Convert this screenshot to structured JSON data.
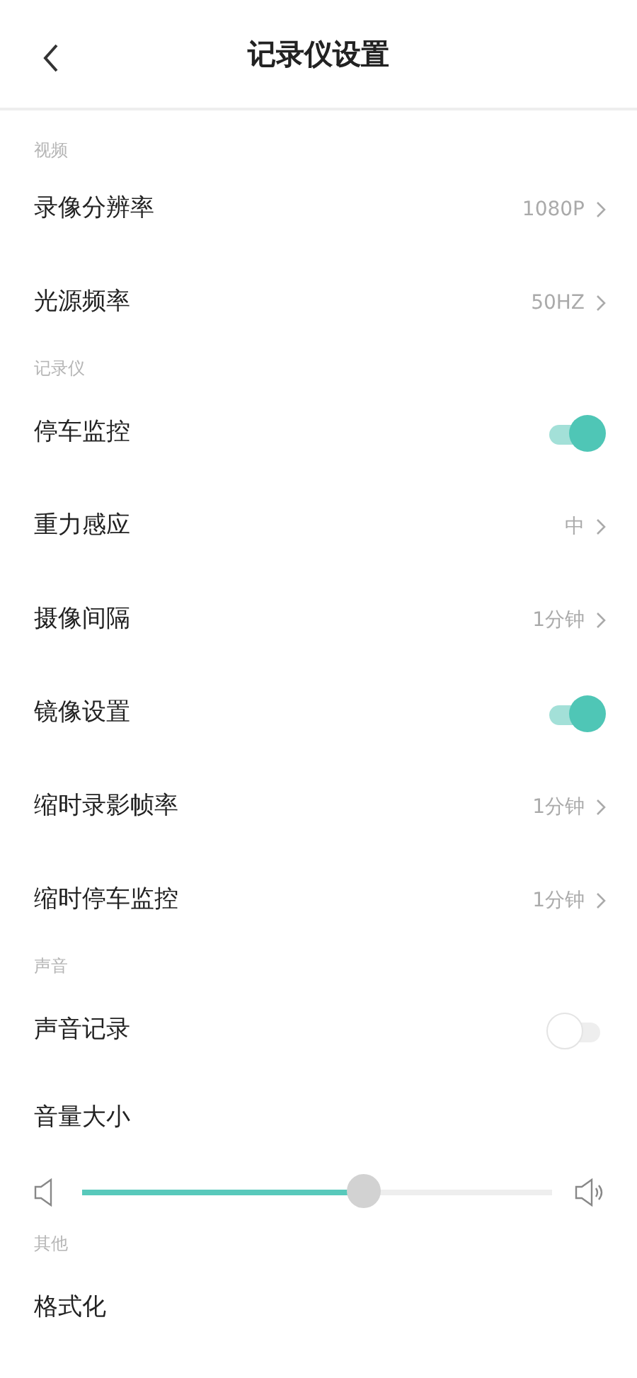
{
  "header": {
    "title": "记录仪设置"
  },
  "sections": [
    {
      "label": "视频",
      "items": [
        {
          "kind": "link",
          "label": "录像分辨率",
          "value": "1080P"
        },
        {
          "kind": "link",
          "label": "光源频率",
          "value": "50HZ"
        }
      ]
    },
    {
      "label": "记录仪",
      "items": [
        {
          "kind": "toggle",
          "label": "停车监控",
          "on": true
        },
        {
          "kind": "link",
          "label": "重力感应",
          "value": "中"
        },
        {
          "kind": "link",
          "label": "摄像间隔",
          "value": "1分钟"
        },
        {
          "kind": "toggle",
          "label": "镜像设置",
          "on": true
        },
        {
          "kind": "link",
          "label": "缩时录影帧率",
          "value": "1分钟"
        },
        {
          "kind": "link",
          "label": "缩时停车监控",
          "value": "1分钟"
        }
      ]
    },
    {
      "label": "声音",
      "items": [
        {
          "kind": "toggle",
          "label": "声音记录",
          "on": false
        },
        {
          "kind": "slider",
          "label": "音量大小",
          "level": 0.6
        }
      ]
    },
    {
      "label": "其他",
      "items": [
        {
          "kind": "plain",
          "label": "格式化"
        }
      ]
    }
  ]
}
